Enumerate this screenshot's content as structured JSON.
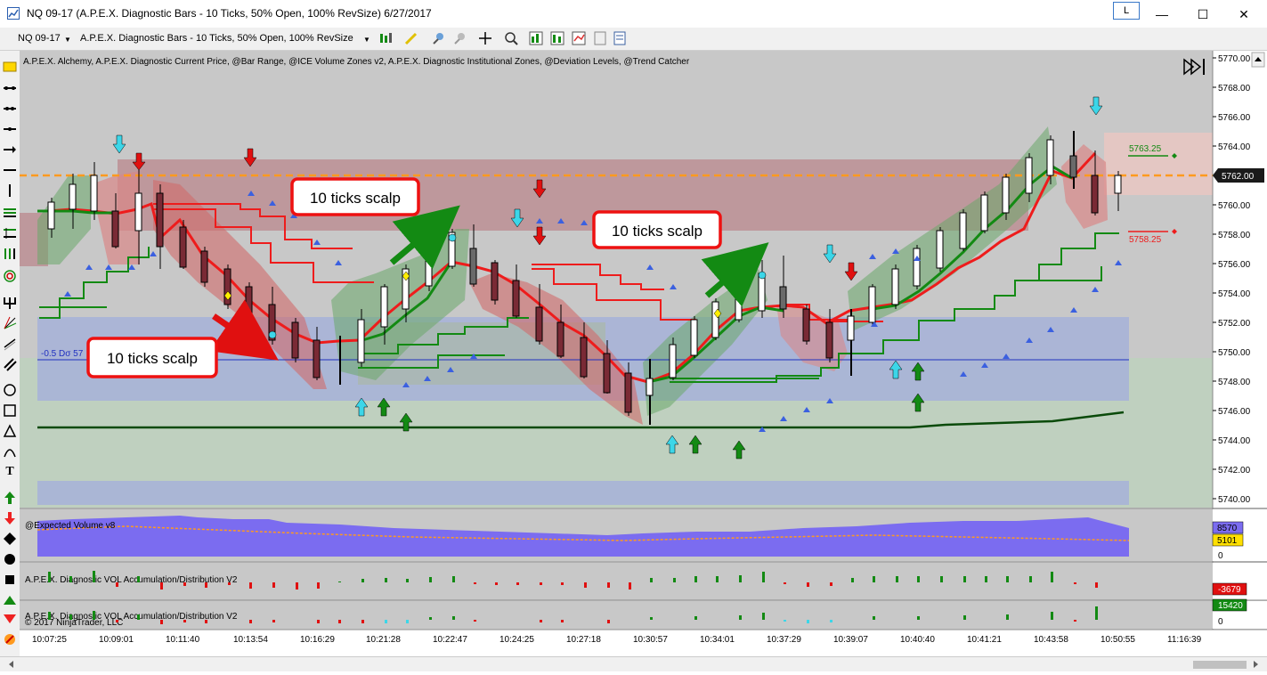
{
  "window": {
    "title": "NQ 09-17 (A.P.E.X. Diagnostic Bars - 10 Ticks, 50% Open, 100% RevSize)  6/27/2017",
    "l_button": "L",
    "minimize": "—",
    "maximize": "☐",
    "close": "✕"
  },
  "toolbar": {
    "instrument": "NQ 09-17",
    "bar_type": "A.P.E.X. Diagnostic Bars - 10 Ticks, 50% Open, 100% RevSize"
  },
  "indicators_label": "A.P.E.X. Alchemy, A.P.E.X. Diagnostic Current Price, @Bar Range, @ICE Volume Zones v2, A.P.E.X. Diagnostic Institutional Zones, @Deviation Levels, @Trend Catcher",
  "colors": {
    "up_trend": "#138a13",
    "down_trend": "#ee1c1c",
    "current_price_line": "#ff9a1f",
    "callout_border": "#ee1111",
    "volume_fill": "#7b6cf0"
  },
  "price_axis": {
    "labels": [
      "5770.00",
      "5768.00",
      "5766.00",
      "5764.00",
      "5762.00",
      "5760.00",
      "5758.00",
      "5756.00",
      "5754.00",
      "5752.00",
      "5750.00",
      "5748.00",
      "5746.00",
      "5744.00",
      "5742.00",
      "5740.00"
    ],
    "current_price": "5762.00",
    "upper_target": "5763.25",
    "lower_target": "5758.25"
  },
  "deviation_label": "-0.5 Dσ 57",
  "callouts": [
    "10 ticks scalp",
    "10 ticks scalp",
    "10 ticks scalp"
  ],
  "panels": {
    "volume": {
      "title": "@Expected Volume v8",
      "value_top": "8570",
      "value_mid": "5101",
      "zero": "0"
    },
    "accdist1": {
      "title": "A.P.E.X. Diagnostic VOL Accumulation/Distribution V2",
      "value": "-3679"
    },
    "accdist2": {
      "title": "A.P.E.X. Diagnostic VOL Accumulation/Distribution V2",
      "value": "15420",
      "zero": "0"
    }
  },
  "copyright": "© 2017 NinjaTrader, LLC",
  "time_axis": [
    "10:07:25",
    "10:09:01",
    "10:11:40",
    "10:13:54",
    "10:16:29",
    "10:21:28",
    "10:22:47",
    "10:24:25",
    "10:27:18",
    "10:30:57",
    "10:34:01",
    "10:37:29",
    "10:39:07",
    "10:40:40",
    "10:41:21",
    "10:43:58",
    "10:50:55",
    "11:16:39"
  ]
}
